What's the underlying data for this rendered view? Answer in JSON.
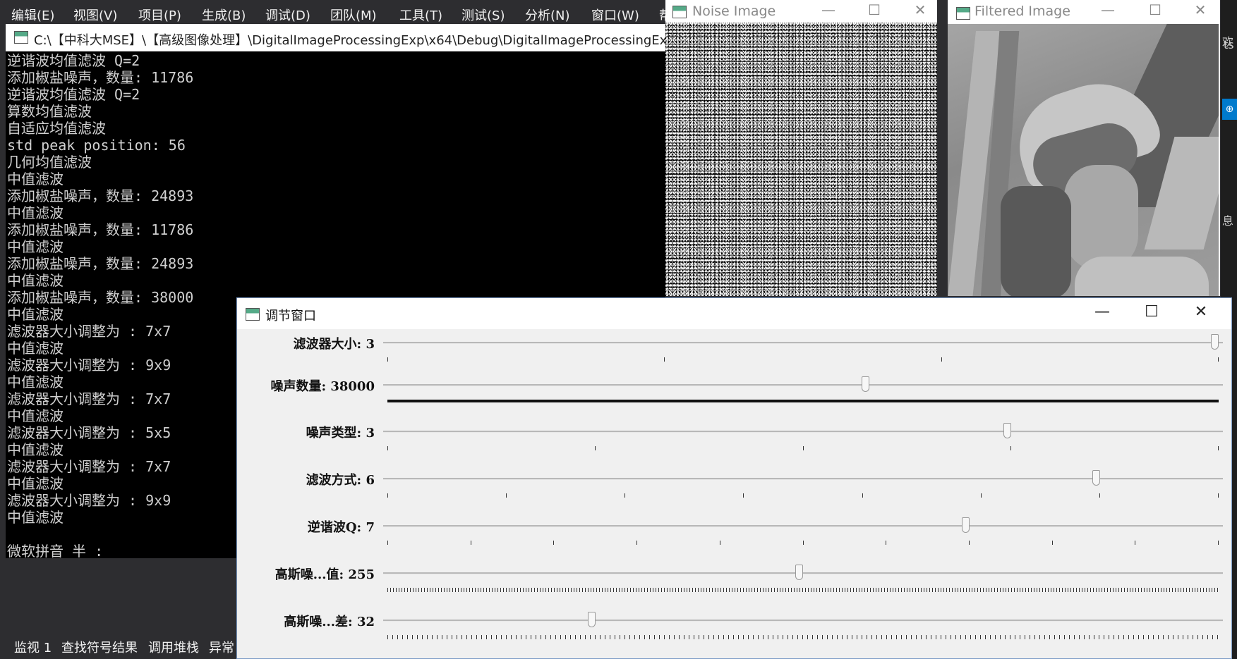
{
  "ide": {
    "menu": [
      "编辑(E)",
      "视图(V)",
      "项目(P)",
      "生成(B)",
      "调试(D)",
      "团队(M)",
      "工具(T)",
      "测试(S)",
      "分析(N)",
      "窗口(W)",
      "帮"
    ],
    "bottom_tabs": [
      "监视 1",
      "查找符号结果",
      "调用堆栈",
      "异常"
    ],
    "right_strip_fragments": [
      "欢 移",
      "ts",
      "息"
    ]
  },
  "console": {
    "title": "C:\\【中科大MSE】\\【高级图像处理】\\DigitalImageProcessingExp\\x64\\Debug\\DigitalImageProcessingExp.",
    "lines": [
      "逆谐波均值滤波 Q=2",
      "添加椒盐噪声，数量: 11786",
      "逆谐波均值滤波 Q=2",
      "算数均值滤波",
      "自适应均值滤波",
      "std peak position: 56",
      "几何均值滤波",
      "中值滤波",
      "添加椒盐噪声，数量: 24893",
      "中值滤波",
      "添加椒盐噪声，数量: 11786",
      "中值滤波",
      "添加椒盐噪声，数量: 24893",
      "中值滤波",
      "添加椒盐噪声，数量: 38000",
      "中值滤波",
      "滤波器大小调整为 : 7x7",
      "中值滤波",
      "滤波器大小调整为 : 9x9",
      "中值滤波",
      "滤波器大小调整为 : 7x7",
      "中值滤波",
      "滤波器大小调整为 : 5x5",
      "中值滤波",
      "滤波器大小调整为 : 7x7",
      "中值滤波",
      "滤波器大小调整为 : 9x9",
      "中值滤波",
      "",
      "微软拼音 半 :"
    ]
  },
  "noise_window": {
    "title": "Noise Image"
  },
  "filtered_window": {
    "title": "Filtered Image"
  },
  "control_window": {
    "title": "调节窗口",
    "trackbars": [
      {
        "label": "滤波器大小: 3",
        "fraction": 1.0,
        "ticks": "sparse",
        "tick_count": 4
      },
      {
        "label": "噪声数量: 38000",
        "fraction": 0.58,
        "ticks": "solid"
      },
      {
        "label": "噪声类型: 3",
        "fraction": 0.75,
        "ticks": "sparse",
        "tick_count": 5
      },
      {
        "label": "滤波方式: 6",
        "fraction": 0.857,
        "ticks": "sparse",
        "tick_count": 8
      },
      {
        "label": "逆谐波Q: 7",
        "fraction": 0.7,
        "ticks": "sparse",
        "tick_count": 11
      },
      {
        "label": "高斯噪...值: 255",
        "fraction": 0.5,
        "ticks": "dense"
      },
      {
        "label": "高斯噪...差: 32",
        "fraction": 0.25,
        "ticks": "sparse-dense"
      }
    ]
  },
  "colors": {
    "ide_bg": "#2d2d30",
    "console_bg": "#000000",
    "console_text": "#d0d0d0",
    "accent": "#007acc"
  }
}
